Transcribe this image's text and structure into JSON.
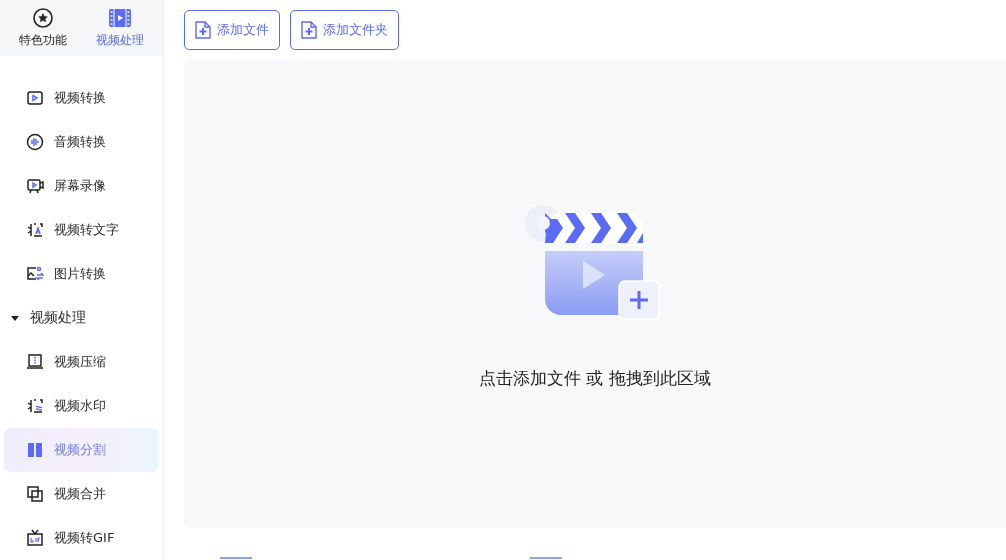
{
  "sidebar": {
    "tabs": [
      {
        "label": "特色功能",
        "selected": false
      },
      {
        "label": "视频处理",
        "selected": true
      }
    ],
    "items": [
      {
        "kind": "item",
        "label": "视频转换",
        "selected": false
      },
      {
        "kind": "item",
        "label": "音频转换",
        "selected": false
      },
      {
        "kind": "item",
        "label": "屏幕录像",
        "selected": false
      },
      {
        "kind": "item",
        "label": "视频转文字",
        "selected": false
      },
      {
        "kind": "item",
        "label": "图片转换",
        "selected": false
      },
      {
        "kind": "group",
        "label": "视频处理",
        "expanded": true,
        "children": [
          {
            "kind": "item",
            "label": "视频压缩",
            "selected": false
          },
          {
            "kind": "item",
            "label": "视频水印",
            "selected": false
          },
          {
            "kind": "item",
            "label": "视频分割",
            "selected": true
          },
          {
            "kind": "item",
            "label": "视频合并",
            "selected": false
          },
          {
            "kind": "item",
            "label": "视频转GIF",
            "selected": false
          }
        ]
      }
    ]
  },
  "toolbar": {
    "buttons": [
      "添加文件",
      "添加文件夹"
    ]
  },
  "dropzone": {
    "hint": "点击添加文件 或 拖拽到此区域"
  }
}
